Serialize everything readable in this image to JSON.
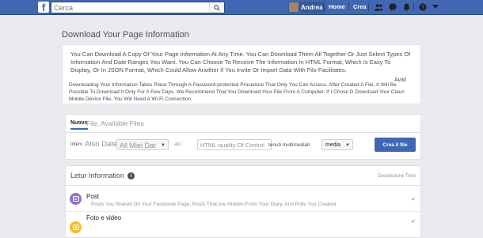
{
  "topbar": {
    "logo": "f",
    "search_placeholder": "Cerca",
    "profile_name": "Andrea",
    "nav": [
      "Home",
      "Crea"
    ],
    "icons": [
      "friends-icon",
      "messenger-icon",
      "notifications-icon",
      "help-icon",
      "dropdown-icon"
    ]
  },
  "page": {
    "title": "Download Your Page Information",
    "intro_p1": "You Can Download A Copy Of Your Page Information At Any Time. You Can Download Them All Together Or Just Select Types Of Information And Date Ranges You Want. You Can Choose To Receive The Information In HTML Format, Which Is Easy To Display, Or In JSON Format, Which Could Allow Another If You Invite Or Import Data With Filo Facilitates.",
    "intro_p2": "Downloading Your Information Takes Place Through A Password-protected Procedure That Only You Can Access. After Created A File, It Will Be Possible To Download It Only For A Few Days. We Recommend That You Download Your File From A Computer. If I Chose D Download Your Claun Mobile Device File, You Will Need A Wi-Fi Connection.",
    "intro_avail": "Avail"
  },
  "files": {
    "tab_new": "Nuovo",
    "tab_available": "File, Available Files",
    "interval_label": "Interv",
    "also_date": "Also Date:",
    "date_value": "All Miei Dat",
    "format_label": "ato:",
    "format_value": "HTML-quality Of Control",
    "media_label": "tenuti multimediali:",
    "media_value": "media",
    "create_button": "Crea il file"
  },
  "info": {
    "header": "Letur Information",
    "badge": "i",
    "deselect": "Deselezione Time",
    "rows": [
      {
        "title": "Post",
        "desc": "Posts You Shared On Your Facebook Page, Posts That Are Hidden From Your Diary, And Polls You Created",
        "icon": "posts-icon",
        "color": "#8c72cb"
      },
      {
        "title": "Foto e video",
        "desc": "",
        "icon": "photo-icon",
        "color": "#f7b928"
      }
    ]
  },
  "colors": {
    "accent": "#4267b2",
    "background": "#e9ebee"
  }
}
